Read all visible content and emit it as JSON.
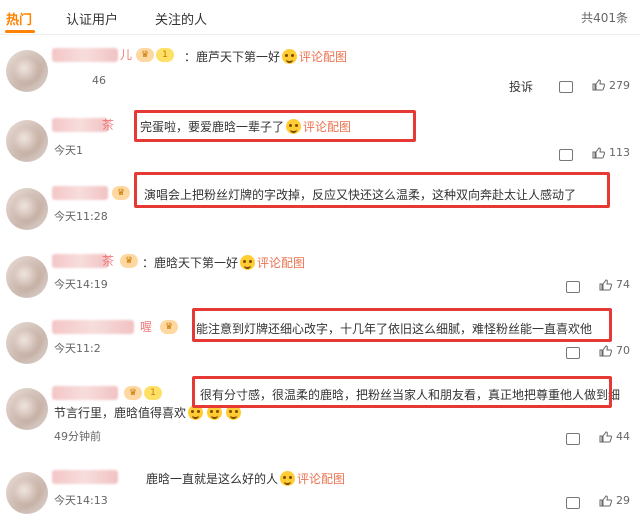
{
  "tabs": [
    "热门",
    "认证用户",
    "关注的人"
  ],
  "total": "共401条",
  "comments": [
    {
      "name_suffix": "儿",
      "text": "鹿芦天下第一好",
      "link": "评论配图",
      "time": "46",
      "report": "投诉",
      "likes": "279"
    },
    {
      "name_suffix": "茶",
      "text": "完蛋啦，要爱鹿晗一辈子了",
      "link": "评论配图",
      "time": "今天1",
      "likes": "113"
    },
    {
      "name_suffix": "",
      "text": "演唱会上把粉丝灯牌的字改掉，反应又快还这么温柔，这种双向奔赴太让人感动了",
      "link": "",
      "time": "今天11:28",
      "likes": "56"
    },
    {
      "name_suffix": "茶",
      "text": "鹿晗天下第一好",
      "link": "评论配图",
      "time": "今天14:19",
      "likes": "74"
    },
    {
      "name_suffix": "喔",
      "text": "能注意到灯牌还细心改字，十几年了依旧这么细腻，难怪粉丝能一直喜欢他",
      "link": "",
      "time": "今天11:2",
      "likes": "70"
    },
    {
      "name_suffix": "",
      "text": "很有分寸感，很温柔的鹿晗，把粉丝当家人和朋友看，真正地把尊重他人做到细",
      "text2": "节言行里，鹿晗值得喜欢",
      "link": "",
      "time": "49分钟前",
      "likes": "44"
    },
    {
      "name_suffix": "",
      "text": "鹿晗一直就是这么好的人",
      "link": "评论配图",
      "time": "今天14:13",
      "likes": "29"
    }
  ]
}
